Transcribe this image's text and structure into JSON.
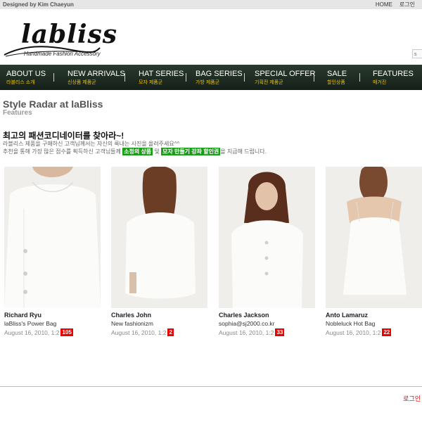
{
  "topbar": {
    "designer": "Designed by Kim Chaeyun",
    "links": [
      "HOME",
      "로그인"
    ]
  },
  "brand": {
    "name": "labliss",
    "tagline": "Handmade Fashion Accessory"
  },
  "search": {
    "stub": "s"
  },
  "nav": [
    {
      "label": "ABOUT US",
      "sub": "라블리스 소개"
    },
    {
      "label": "NEW ARRIVALS",
      "sub": "신상품 제품군"
    },
    {
      "label": "HAT SERIES",
      "sub": "모자 제품군"
    },
    {
      "label": "BAG SERIES",
      "sub": "가방 제품군"
    },
    {
      "label": "SPECIAL OFFER",
      "sub": "기획전 제품군"
    },
    {
      "label": "SALE",
      "sub": "할인상품"
    },
    {
      "label": "FEATURES",
      "sub": "매거진"
    }
  ],
  "page": {
    "title": "Style Radar at laBliss",
    "subtitle": "Features"
  },
  "promo": {
    "heading": "최고의 패션코디네이터를 찾아라~!",
    "line1": "라블리스 제품을 구매하신 고객님께서는 자신의 룩내는 사진을 올려주세요^^",
    "line2_a": "추천을 통해 가장 많은 점수를 획득하신 고객님들께",
    "highlight1": "소정의 상품",
    "line2_b": "및",
    "highlight2": "모자 만들기 강좌 할인권",
    "line2_c": "을 지급해 드립니다."
  },
  "cards": [
    {
      "name": "Richard Ryu",
      "title": "laBliss's Power Bag",
      "date": "August 16, 2010, 1:2",
      "count": "105"
    },
    {
      "name": "Charles John",
      "title": "New fashionizm",
      "date": "August 16, 2010, 1:2",
      "count": "2"
    },
    {
      "name": "Charles Jackson",
      "title": "sophia@sj2000.co.kr",
      "date": "August 16, 2010, 1:2",
      "count": "33"
    },
    {
      "name": "Anto Lamaruz",
      "title": "Nobleluck Hot Bag",
      "date": "August 16, 2010, 1:2",
      "count": "22"
    }
  ],
  "footer": {
    "login": "로그인"
  }
}
